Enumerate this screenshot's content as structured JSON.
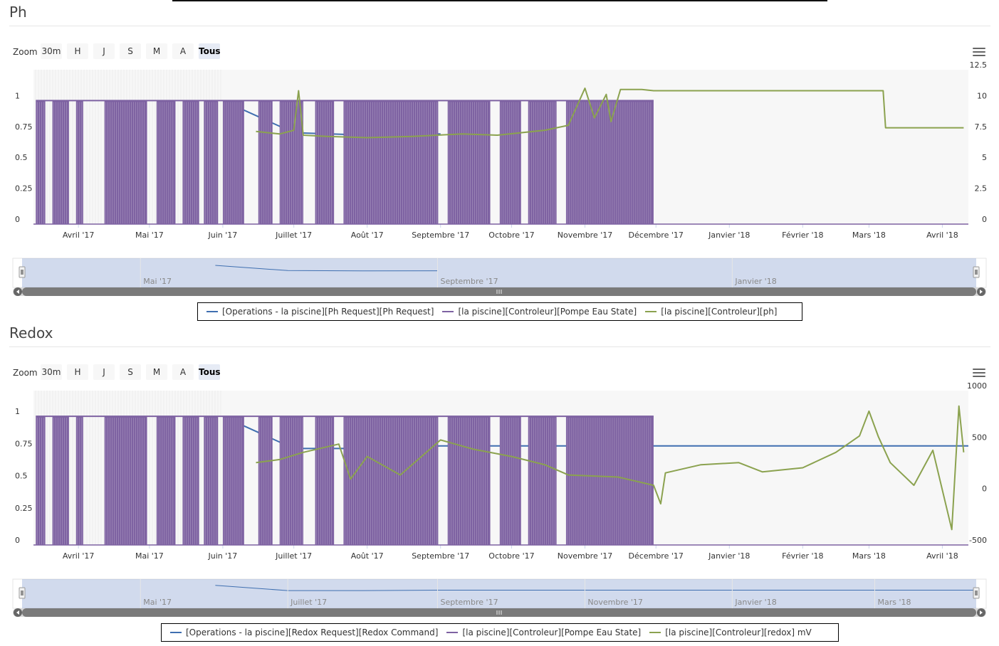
{
  "chart_data": [
    {
      "type": "line",
      "title": "Ph",
      "zoom": {
        "label": "Zoom",
        "buttons": [
          "30m",
          "H",
          "J",
          "S",
          "M",
          "A",
          "Tous"
        ],
        "selected": "Tous"
      },
      "x_range": [
        "2017-03-13",
        "2018-04-12"
      ],
      "x_ticks": [
        "Avril '17",
        "Mai '17",
        "Juin '17",
        "Juillet '17",
        "Août '17",
        "Septembre '17",
        "Octobre '17",
        "Novembre '17",
        "Décembre '17",
        "Janvier '18",
        "Février '18",
        "Mars '18",
        "Avril '18"
      ],
      "y_left": {
        "ticks": [
          "0",
          "0.25",
          "0.5",
          "0.75",
          "1"
        ],
        "range": [
          0,
          1.25
        ]
      },
      "y_right": {
        "ticks": [
          "0",
          "2.5",
          "5",
          "7.5",
          "10",
          "12.5"
        ],
        "range": [
          0,
          12.5
        ]
      },
      "navigator_labels": [
        "Mai '17",
        "Septembre '17",
        "Janvier '18"
      ],
      "series": [
        {
          "name": "[Operations - la piscine][Ph Request][Ph Request]",
          "color": "#3f6fb0",
          "axis": "left",
          "points": [
            [
              "2017-06-01",
              1.0
            ],
            [
              "2017-07-01",
              0.74
            ],
            [
              "2017-08-01",
              0.72
            ],
            [
              "2017-09-01",
              0.73
            ]
          ]
        },
        {
          "name": "[la piscine][Controleur][Pompe Eau State]",
          "color": "#7e62a2",
          "axis": "left",
          "blocks": [
            [
              "2017-03-14",
              "2017-03-18"
            ],
            [
              "2017-03-21",
              "2017-03-28"
            ],
            [
              "2017-03-31",
              "2017-04-03"
            ],
            [
              "2017-04-12",
              "2017-04-30"
            ],
            [
              "2017-05-04",
              "2017-05-12"
            ],
            [
              "2017-05-15",
              "2017-05-22"
            ],
            [
              "2017-05-24",
              "2017-05-30"
            ],
            [
              "2017-06-01",
              "2017-06-10"
            ],
            [
              "2017-06-16",
              "2017-06-22"
            ],
            [
              "2017-06-25",
              "2017-07-05"
            ],
            [
              "2017-07-10",
              "2017-07-18"
            ],
            [
              "2017-07-22",
              "2017-08-31"
            ],
            [
              "2017-09-04",
              "2017-09-22"
            ],
            [
              "2017-09-26",
              "2017-10-05"
            ],
            [
              "2017-10-08",
              "2017-10-20"
            ],
            [
              "2017-10-24",
              "2017-11-30"
            ]
          ],
          "low_until": "2018-04-12"
        },
        {
          "name": "[la piscine][Controleur][ph]",
          "color": "#8ba24f",
          "axis": "right",
          "points": [
            [
              "2017-06-15",
              7.5
            ],
            [
              "2017-06-25",
              7.3
            ],
            [
              "2017-07-01",
              7.6
            ],
            [
              "2017-07-03",
              10.8
            ],
            [
              "2017-07-05",
              7.2
            ],
            [
              "2017-07-15",
              7.1
            ],
            [
              "2017-08-01",
              7.0
            ],
            [
              "2017-08-20",
              7.1
            ],
            [
              "2017-09-10",
              7.3
            ],
            [
              "2017-09-25",
              7.2
            ],
            [
              "2017-10-15",
              7.6
            ],
            [
              "2017-10-25",
              8.0
            ],
            [
              "2017-11-01",
              11.0
            ],
            [
              "2017-11-05",
              8.6
            ],
            [
              "2017-11-10",
              10.5
            ],
            [
              "2017-11-12",
              8.3
            ],
            [
              "2017-11-16",
              10.9
            ],
            [
              "2017-11-25",
              10.9
            ],
            [
              "2017-11-30",
              10.8
            ],
            [
              "2018-03-07",
              10.8
            ],
            [
              "2018-03-08",
              7.8
            ],
            [
              "2018-04-10",
              7.8
            ]
          ]
        }
      ]
    },
    {
      "type": "line",
      "title": "Redox",
      "zoom": {
        "label": "Zoom",
        "buttons": [
          "30m",
          "H",
          "J",
          "S",
          "M",
          "A",
          "Tous"
        ],
        "selected": "Tous"
      },
      "x_range": [
        "2017-03-13",
        "2018-04-12"
      ],
      "x_ticks": [
        "Avril '17",
        "Mai '17",
        "Juin '17",
        "Juillet '17",
        "Août '17",
        "Septembre '17",
        "Octobre '17",
        "Novembre '17",
        "Décembre '17",
        "Janvier '18",
        "Février '18",
        "Mars '18",
        "Avril '18"
      ],
      "y_left": {
        "ticks": [
          "0",
          "0.25",
          "0.5",
          "0.75",
          "1"
        ],
        "range": [
          0,
          1.2
        ]
      },
      "y_right": {
        "ticks": [
          "-500",
          "0",
          "500",
          "1000"
        ],
        "range": [
          -500,
          1000
        ]
      },
      "navigator_labels": [
        "Mai '17",
        "Juillet '17",
        "Septembre '17",
        "Novembre '17",
        "Janvier '18",
        "Mars '18"
      ],
      "series": [
        {
          "name": "[Operations - la piscine][Redox Request][Redox Command]",
          "color": "#3f6fb0",
          "axis": "left",
          "points": [
            [
              "2017-06-01",
              1.0
            ],
            [
              "2017-07-01",
              0.75
            ],
            [
              "2017-08-01",
              0.75
            ],
            [
              "2017-09-01",
              0.77
            ],
            [
              "2018-04-12",
              0.77
            ]
          ]
        },
        {
          "name": "[la piscine][Controleur][Pompe Eau State]",
          "color": "#7e62a2",
          "axis": "left",
          "blocks": [
            [
              "2017-03-14",
              "2017-03-18"
            ],
            [
              "2017-03-21",
              "2017-03-28"
            ],
            [
              "2017-03-31",
              "2017-04-03"
            ],
            [
              "2017-04-12",
              "2017-04-30"
            ],
            [
              "2017-05-04",
              "2017-05-12"
            ],
            [
              "2017-05-15",
              "2017-05-22"
            ],
            [
              "2017-05-24",
              "2017-05-30"
            ],
            [
              "2017-06-01",
              "2017-06-10"
            ],
            [
              "2017-06-16",
              "2017-06-22"
            ],
            [
              "2017-06-25",
              "2017-07-05"
            ],
            [
              "2017-07-10",
              "2017-07-18"
            ],
            [
              "2017-07-22",
              "2017-08-31"
            ],
            [
              "2017-09-04",
              "2017-09-22"
            ],
            [
              "2017-09-26",
              "2017-10-05"
            ],
            [
              "2017-10-08",
              "2017-10-20"
            ],
            [
              "2017-10-24",
              "2017-11-30"
            ]
          ],
          "low_until": "2018-04-12"
        },
        {
          "name": "[la piscine][Controleur][redox] mV",
          "color": "#8ba24f",
          "axis": "right",
          "points": [
            [
              "2017-06-15",
              300
            ],
            [
              "2017-06-25",
              330
            ],
            [
              "2017-07-05",
              400
            ],
            [
              "2017-07-20",
              480
            ],
            [
              "2017-07-25",
              140
            ],
            [
              "2017-08-01",
              360
            ],
            [
              "2017-08-15",
              180
            ],
            [
              "2017-09-01",
              520
            ],
            [
              "2017-09-15",
              430
            ],
            [
              "2017-10-01",
              360
            ],
            [
              "2017-10-15",
              280
            ],
            [
              "2017-10-25",
              180
            ],
            [
              "2017-11-15",
              160
            ],
            [
              "2017-11-30",
              80
            ],
            [
              "2017-12-03",
              -100
            ],
            [
              "2017-12-05",
              200
            ],
            [
              "2017-12-20",
              280
            ],
            [
              "2018-01-05",
              300
            ],
            [
              "2018-01-15",
              210
            ],
            [
              "2018-02-01",
              250
            ],
            [
              "2018-02-15",
              400
            ],
            [
              "2018-02-25",
              560
            ],
            [
              "2018-03-01",
              800
            ],
            [
              "2018-03-05",
              550
            ],
            [
              "2018-03-10",
              300
            ],
            [
              "2018-03-20",
              80
            ],
            [
              "2018-03-28",
              420
            ],
            [
              "2018-04-05",
              -350
            ],
            [
              "2018-04-08",
              850
            ],
            [
              "2018-04-10",
              400
            ]
          ]
        }
      ]
    }
  ]
}
